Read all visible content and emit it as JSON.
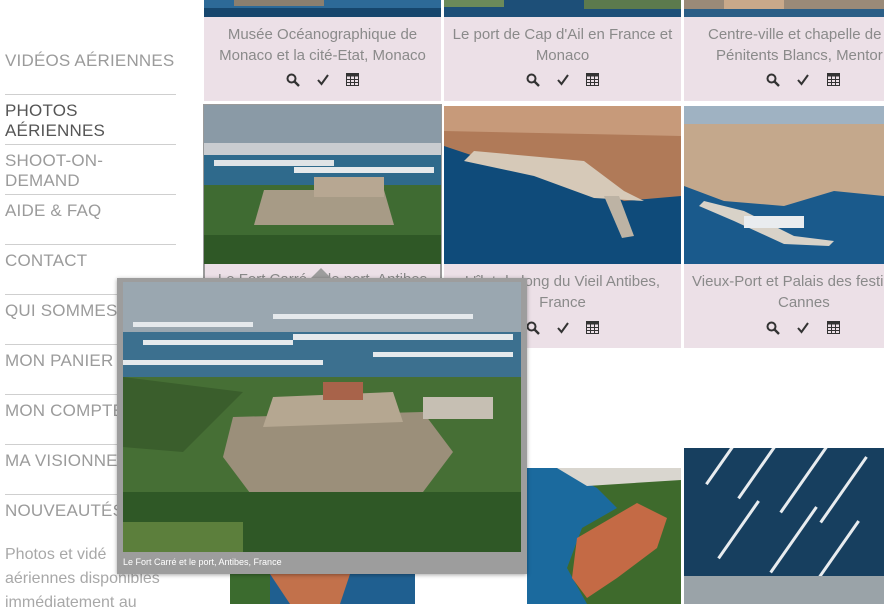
{
  "nav": {
    "items": [
      {
        "label": "VIDÉOS AÉRIENNES",
        "active": false
      },
      {
        "label": "PHOTOS AÉRIENNES",
        "active": true
      },
      {
        "label": "SHOOT-ON-DEMAND",
        "active": false
      },
      {
        "label": "AIDE & FAQ",
        "active": false
      },
      {
        "label": "CONTACT",
        "active": false
      },
      {
        "label": "QUI SOMMES",
        "active": false
      },
      {
        "label": "MON PANIER",
        "active": false
      },
      {
        "label": "MON COMPTE",
        "active": false
      },
      {
        "label": "MA VISIONNEU",
        "active": false
      },
      {
        "label": "NOUVEAUTÉS",
        "active": false
      }
    ],
    "promo_line1": "Photos et vidé",
    "promo_line2": "aériennes disponibles",
    "promo_line3": "immédiatement au"
  },
  "cards": {
    "c1": {
      "line1": "Musée Océanographique de",
      "line2": "Monaco et la cité-Etat, Monaco"
    },
    "c2": {
      "line1": "Le port de Cap d'Ail en France et",
      "line2": "Monaco"
    },
    "c3": {
      "line1": "Centre-ville et chapelle de",
      "line2": "Pénitents Blancs, Mentor"
    },
    "c4": {
      "line1": "Le Fort Carré et le port, Antibes",
      "line2": ""
    },
    "c5": {
      "line1": "L'îlot du long du Vieil Antibes,",
      "line2": "France"
    },
    "c6": {
      "line1": "Vieux-Port et Palais des festi",
      "line2": "Cannes"
    }
  },
  "popup": {
    "caption": "Le Fort Carré et le port, Antibes, France"
  },
  "colors": {
    "card_bg": "#ece0e7",
    "nav_text": "#9b9b9b",
    "nav_active": "#555555",
    "sea": "#1f5f8f",
    "popup_frame": "#9d9d9d"
  },
  "icons": [
    "search-icon",
    "check-icon",
    "calculator-icon"
  ]
}
